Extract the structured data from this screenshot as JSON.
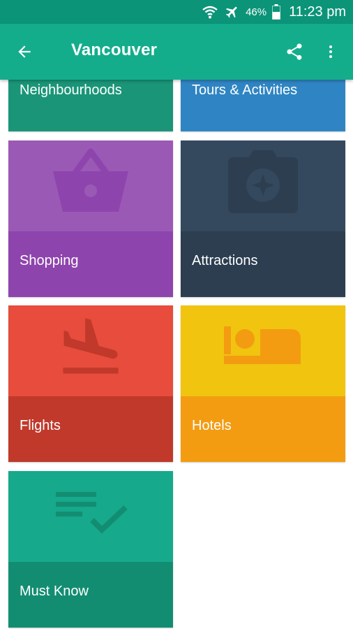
{
  "status_bar": {
    "battery_percent": "46%",
    "time": "11:23 pm",
    "icons": [
      "wifi-icon",
      "airplane-mode-icon",
      "battery-icon"
    ]
  },
  "app_bar": {
    "title": "Vancouver",
    "back_icon": "arrow-back-icon",
    "share_icon": "share-icon",
    "more_icon": "more-vert-icon",
    "color": "#14ad8c"
  },
  "tiles": [
    {
      "label": "Neighbourhoods",
      "icon": "none",
      "color": "#1a9578"
    },
    {
      "label": "Tours & Activities",
      "icon": "none",
      "color": "#2f85c3"
    },
    {
      "label": "Shopping",
      "icon": "shopping-basket-icon",
      "color": "#8e44ad"
    },
    {
      "label": "Attractions",
      "icon": "camera-icon",
      "color": "#2c3e50"
    },
    {
      "label": "Flights",
      "icon": "flight-land-icon",
      "color": "#c0392b"
    },
    {
      "label": "Hotels",
      "icon": "hotel-bed-icon",
      "color": "#f39c12"
    },
    {
      "label": "Must Know",
      "icon": "checklist-icon",
      "color": "#138d72"
    }
  ]
}
